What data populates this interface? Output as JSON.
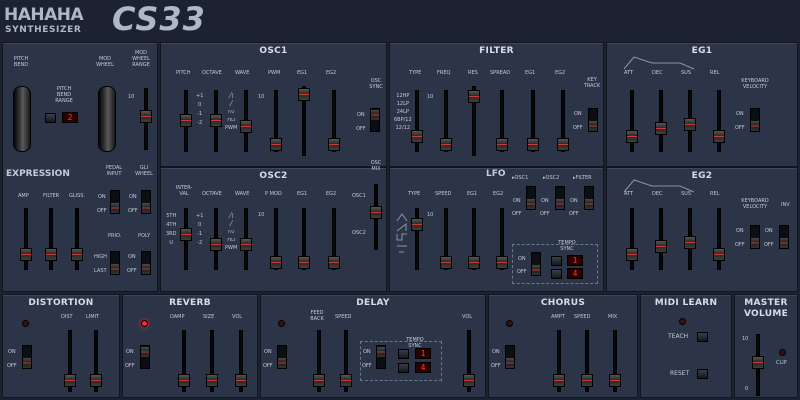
{
  "brand": {
    "name": "HAHAHA",
    "sub": "SYNTHESIZER",
    "model": "CS33"
  },
  "left": {
    "pitch_bend": "PITCH BEND",
    "mod_wheel": "MOD WHEEL",
    "mod_wheel_range": "MOD WHEEL RANGE",
    "pbr": "PITCH BEND RANGE",
    "pbr_value": "2",
    "expression": "EXPRESSION",
    "amp": "AMP",
    "filter": "FILTER",
    "gliss": "GLISS.",
    "pedal_input": "PEDAL INPUT",
    "gli_wheel": "GLI WHEEL",
    "prio": "PRIO.",
    "poly": "POLY",
    "high": "HIGH",
    "last": "LAST",
    "on": "ON",
    "off": "OFF",
    "scale_top": "10",
    "scale_bottom": "0"
  },
  "osc1": {
    "title": "OSC1",
    "pitch": "PITCH",
    "octave": "OCTAVE",
    "wave": "WAVE",
    "pwm": "PWM",
    "eg1": "EG1",
    "eg2": "EG2",
    "osc_sync": "OSC SYNC",
    "oct": [
      "+1",
      "0",
      "-1",
      "-2"
    ],
    "wave_lbl": [
      "╱|",
      "╱",
      "∩∪",
      "⊓⊔",
      "PWM"
    ],
    "on": "ON",
    "off": "OFF",
    "s10": "10",
    "s0": "0"
  },
  "osc2": {
    "title": "OSC2",
    "interval": "INTER-VAL",
    "octave": "OCTAVE",
    "wave": "WAVE",
    "pmod": "P MOD",
    "eg1": "EG1",
    "eg2": "EG2",
    "osc_mix": "OSC MIX",
    "osc1": "OSC1",
    "osc2": "OSC2",
    "intv": [
      "5TH",
      "4TH",
      "3RD",
      "U"
    ],
    "oct": [
      "+1",
      "0",
      "-1",
      "-2"
    ],
    "s10": "10",
    "s0": "0"
  },
  "filter": {
    "title": "FILTER",
    "type": "TYPE",
    "freq": "FREQ",
    "res": "RES",
    "spread": "SPREAD",
    "eg1": "EG1",
    "eg2": "EG2",
    "key_track": "KEY TRACK",
    "types": [
      "12HP",
      "12LP",
      "24LP",
      "6BP/12",
      "12/12"
    ],
    "on": "ON",
    "off": "OFF",
    "s10": "10",
    "s0": "0"
  },
  "eg1": {
    "title": "EG1",
    "att": "ATT",
    "dec": "DEC",
    "sus": "SUS",
    "rel": "REL",
    "kv": "KEYBOARD VELOCITY",
    "on": "ON",
    "off": "OFF",
    "s10": "10",
    "s0": "0"
  },
  "lfo": {
    "title": "LFO",
    "type": "TYPE",
    "speed": "SPEED",
    "eg1": "EG1",
    "eg2": "EG2",
    "to_osc1": "▸OSC1",
    "to_osc2": "▸OSC2",
    "to_filter": "▸FILTER",
    "tempo_sync": "TEMPO SYNC",
    "v1": "1",
    "v2": "4",
    "on": "ON",
    "off": "OFF",
    "s10": "10",
    "s0": "0"
  },
  "eg2": {
    "title": "EG2",
    "att": "ATT",
    "dec": "DEC",
    "sus": "SUS",
    "rel": "REL",
    "kv": "KEYBOARD VELOCITY",
    "inv": "INV",
    "on": "ON",
    "off": "OFF",
    "s10": "10",
    "s0": "0"
  },
  "distortion": {
    "title": "DISTORTION",
    "dist": "DIST",
    "limit": "LIMIT",
    "on": "ON",
    "off": "OFF"
  },
  "reverb": {
    "title": "REVERB",
    "damp": "DAMP",
    "size": "SIZE",
    "vol": "VOL",
    "on": "ON",
    "off": "OFF"
  },
  "delay": {
    "title": "DELAY",
    "feed": "FEED BACK",
    "speed": "SPEED",
    "vol": "VOL",
    "tempo_sync": "TEMPO SYNC",
    "v1": "1",
    "v2": "4",
    "on": "ON",
    "off": "OFF"
  },
  "chorus": {
    "title": "CHORUS",
    "ampt": "AMPT",
    "speed": "SPEED",
    "mix": "MIX",
    "on": "ON",
    "off": "OFF"
  },
  "midi": {
    "title": "MIDI LEARN",
    "teach": "TEACH",
    "reset": "RESET"
  },
  "master": {
    "title": "MASTER VOLUME",
    "clip": "CLIP",
    "s10": "10",
    "s0": "0"
  },
  "colors": {
    "panel": "#2c3547",
    "fader_cap": "#cc3a3a",
    "led": "#ff2a2a"
  }
}
